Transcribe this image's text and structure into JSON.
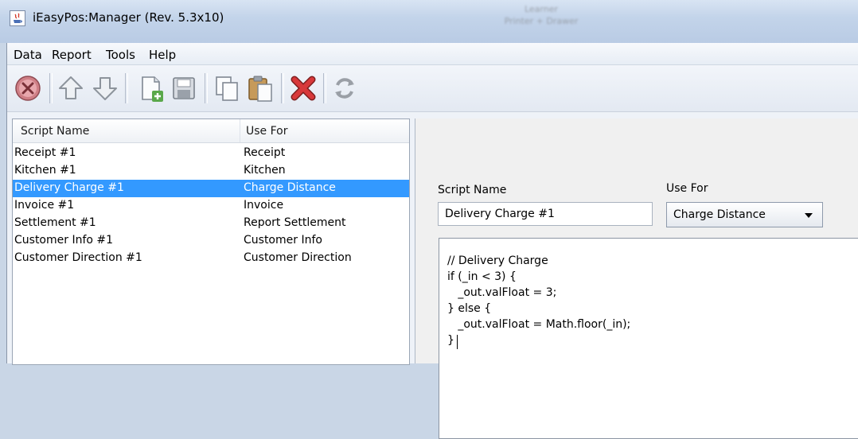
{
  "window": {
    "title": "iEasyPos:Manager (Rev. 5.3x10)"
  },
  "background_text": [
    "Learner",
    "Printer + Drawer"
  ],
  "menu": [
    "Data",
    "Report",
    "Tools",
    "Help"
  ],
  "toolbar": {
    "buttons": [
      "close-icon",
      "up-arrow-icon",
      "down-arrow-icon",
      "new-document-icon",
      "save-icon",
      "copy-icon",
      "paste-icon",
      "delete-icon",
      "refresh-icon"
    ]
  },
  "list": {
    "headers": {
      "name": "Script Name",
      "use_for": "Use For"
    },
    "rows": [
      {
        "name": "Receipt #1",
        "use_for": "Receipt"
      },
      {
        "name": "Kitchen #1",
        "use_for": "Kitchen"
      },
      {
        "name": "Delivery Charge #1",
        "use_for": "Charge Distance"
      },
      {
        "name": "Invoice #1",
        "use_for": "Invoice"
      },
      {
        "name": "Settlement #1",
        "use_for": "Report Settlement"
      },
      {
        "name": "Customer Info #1",
        "use_for": "Customer Info"
      },
      {
        "name": "Customer Direction #1",
        "use_for": "Customer Direction"
      }
    ],
    "selected_index": 2,
    "selection_color": "#3399ff"
  },
  "detail": {
    "script_name_label": "Script Name",
    "script_name_value": "Delivery Charge #1",
    "use_for_label": "Use For",
    "use_for_value": "Charge Distance",
    "code": [
      "// Delivery Charge",
      "if (_in < 3) {",
      "   _out.valFloat = 3;",
      "} else {",
      "   _out.valFloat = Math.floor(_in);",
      "}"
    ]
  }
}
